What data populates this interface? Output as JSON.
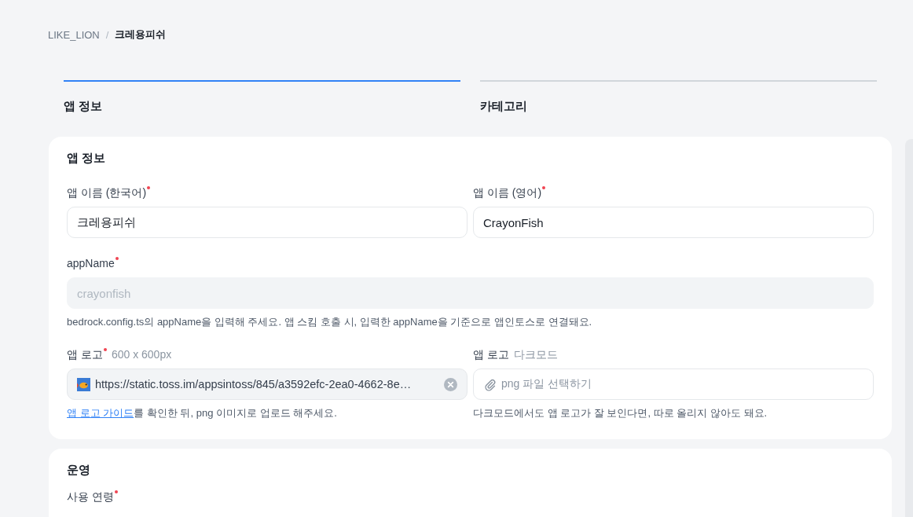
{
  "breadcrumb_separator": "/",
  "breadcrumb": [
    {
      "label": "LIKE_LION",
      "current": false
    },
    {
      "label": "크레용피쉬",
      "current": true
    }
  ],
  "tabs": [
    {
      "label": "앱 정보",
      "selected": true
    },
    {
      "label": "카테고리",
      "selected": false
    }
  ],
  "sections": [
    {
      "title": "앱 정보",
      "rows": [
        [
          {
            "label": "앱 이름 (한국어)",
            "required": true,
            "kind": "text",
            "value": "크레용피쉬",
            "disabled": false
          },
          {
            "label": "앱 이름 (영어)",
            "required": true,
            "kind": "text",
            "value": "CrayonFish",
            "disabled": false
          }
        ],
        [
          {
            "label": "appName",
            "required": true,
            "kind": "text",
            "value": "crayonfish",
            "disabled": true,
            "help": "bedrock.config.ts의 appName을 입력해 주세요. 앱 스킴 호출 시, 입력한 appName을 기준으로 앱인토스로 연결돼요."
          }
        ],
        [
          {
            "label": "앱 로고",
            "required": true,
            "note": "600 x 600px",
            "kind": "file",
            "value": "https://static.toss.im/appsintoss/845/a3592efc-2ea0-4662-8e…",
            "help_link": "앱 로고 가이드",
            "help": "를 확인한 뒤, png 이미지로 업로드 해주세요."
          },
          {
            "label": "앱 로고",
            "note": "다크모드",
            "kind": "file",
            "placeholder": "png 파일 선택하기",
            "help": "다크모드에서도 앱 로고가 잘 보인다면, 따로 올리지 않아도 돼요."
          }
        ]
      ]
    },
    {
      "title": "운영",
      "rows": [
        [
          {
            "label": "사용 연령",
            "required": true
          }
        ]
      ]
    }
  ]
}
